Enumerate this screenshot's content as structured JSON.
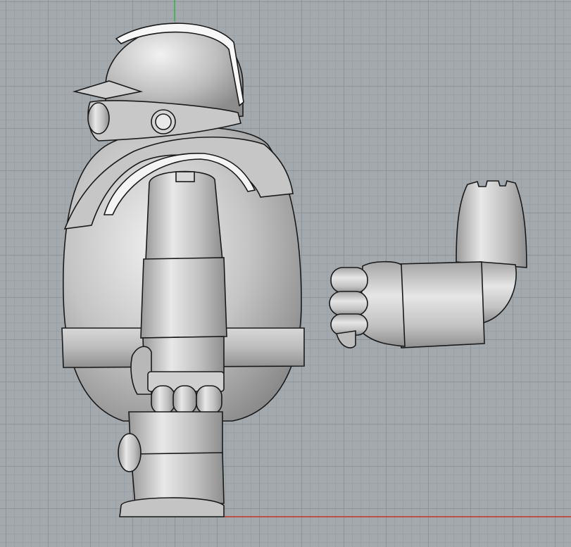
{
  "viewport": {
    "view": "side-orthographic",
    "grid": true,
    "axis_y_color": "#2fb84a",
    "axis_x_color": "#c0392b",
    "background_color": "#a4a9ae"
  },
  "model": {
    "parts": [
      "helmet",
      "goggles",
      "shoulder-armor",
      "body",
      "belt",
      "arm",
      "fist",
      "boot",
      "detached-arm-assembly"
    ],
    "color": "#c9c9c9"
  }
}
